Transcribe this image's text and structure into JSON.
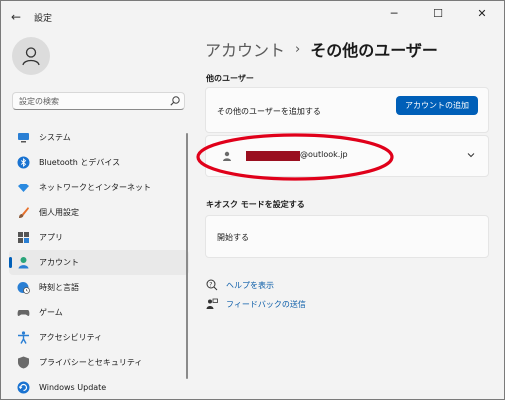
{
  "window": {
    "title": "設定",
    "back_icon": "←",
    "minimize_icon": "─",
    "maximize_icon": "☐",
    "close_icon": "✕"
  },
  "search": {
    "placeholder": "設定の検索"
  },
  "sidebar": {
    "items": [
      {
        "label": "システム",
        "icon": "monitor-icon"
      },
      {
        "label": "Bluetooth とデバイス",
        "icon": "bluetooth-icon"
      },
      {
        "label": "ネットワークとインターネット",
        "icon": "wifi-icon"
      },
      {
        "label": "個人用設定",
        "icon": "brush-icon"
      },
      {
        "label": "アプリ",
        "icon": "apps-icon"
      },
      {
        "label": "アカウント",
        "icon": "person-icon",
        "active": true
      },
      {
        "label": "時刻と言語",
        "icon": "globe-clock-icon"
      },
      {
        "label": "ゲーム",
        "icon": "gamepad-icon"
      },
      {
        "label": "アクセシビリティ",
        "icon": "accessibility-icon"
      },
      {
        "label": "プライバシーとセキュリティ",
        "icon": "shield-icon"
      },
      {
        "label": "Windows Update",
        "icon": "update-icon"
      }
    ]
  },
  "breadcrumb": {
    "parent": "アカウント",
    "separator": "›",
    "current": "その他のユーザー"
  },
  "other_users": {
    "heading": "他のユーザー",
    "add_label": "その他のユーザーを追加する",
    "add_button": "アカウントの追加",
    "user_email_suffix": "@outlook.jp"
  },
  "kiosk": {
    "heading": "キオスク モードを設定する",
    "start_label": "開始する"
  },
  "links": {
    "help": "ヘルプを表示",
    "feedback": "フィードバックの送信"
  },
  "colors": {
    "accent": "#005fb8",
    "highlight": "#e0001a",
    "redaction": "#9a0f1f"
  }
}
